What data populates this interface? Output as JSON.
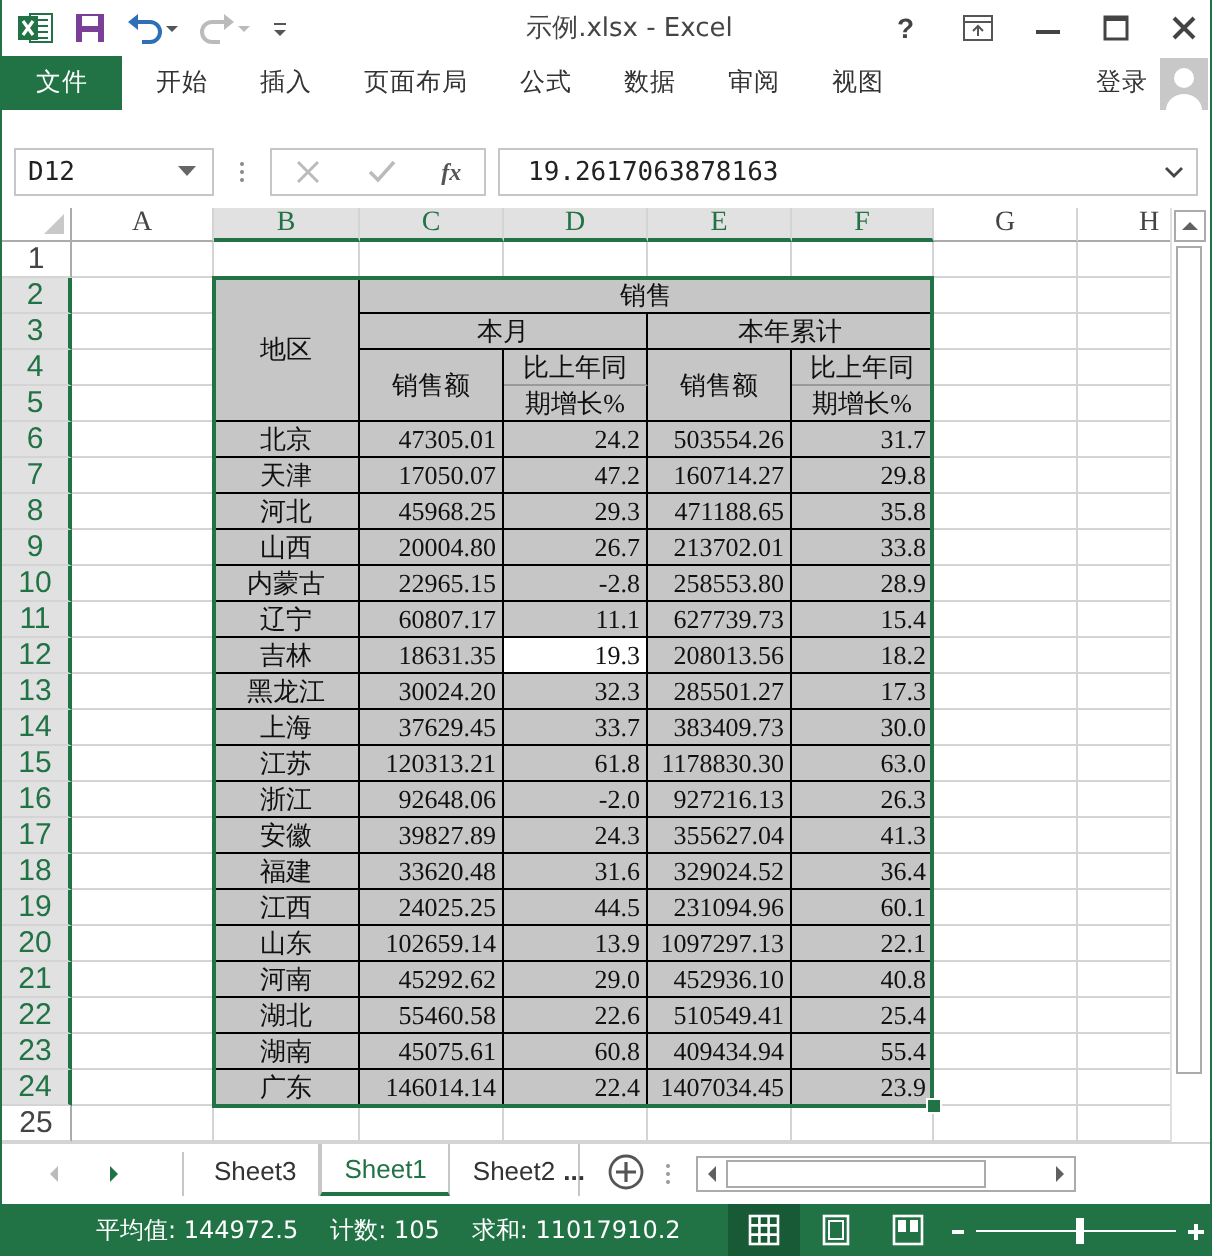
{
  "window": {
    "title": "示例.xlsx - Excel",
    "help": "?"
  },
  "ribbon": {
    "tabs": [
      {
        "label": "文件",
        "kind": "file"
      },
      {
        "label": "开始",
        "kind": "tab"
      },
      {
        "label": "插入",
        "kind": "tab"
      },
      {
        "label": "页面布局",
        "kind": "tab"
      },
      {
        "label": "公式",
        "kind": "tab"
      },
      {
        "label": "数据",
        "kind": "tab"
      },
      {
        "label": "审阅",
        "kind": "tab"
      },
      {
        "label": "视图",
        "kind": "tab"
      }
    ],
    "account": "登录"
  },
  "formula_bar": {
    "name_box": "D12",
    "function_label": "fx",
    "formula": "19.2617063878163"
  },
  "columns": [
    {
      "label": "A",
      "selected": false
    },
    {
      "label": "B",
      "selected": true
    },
    {
      "label": "C",
      "selected": true
    },
    {
      "label": "D",
      "selected": true
    },
    {
      "label": "E",
      "selected": true
    },
    {
      "label": "F",
      "selected": true
    },
    {
      "label": "G",
      "selected": false
    },
    {
      "label": "H",
      "selected": false
    }
  ],
  "rows": [
    {
      "label": "1",
      "selected": false
    },
    {
      "label": "2",
      "selected": true
    },
    {
      "label": "3",
      "selected": true
    },
    {
      "label": "4",
      "selected": true
    },
    {
      "label": "5",
      "selected": true
    },
    {
      "label": "6",
      "selected": true
    },
    {
      "label": "7",
      "selected": true
    },
    {
      "label": "8",
      "selected": true
    },
    {
      "label": "9",
      "selected": true
    },
    {
      "label": "10",
      "selected": true
    },
    {
      "label": "11",
      "selected": true
    },
    {
      "label": "12",
      "selected": true
    },
    {
      "label": "13",
      "selected": true
    },
    {
      "label": "14",
      "selected": true
    },
    {
      "label": "15",
      "selected": true
    },
    {
      "label": "16",
      "selected": true
    },
    {
      "label": "17",
      "selected": true
    },
    {
      "label": "18",
      "selected": true
    },
    {
      "label": "19",
      "selected": true
    },
    {
      "label": "20",
      "selected": true
    },
    {
      "label": "21",
      "selected": true
    },
    {
      "label": "22",
      "selected": true
    },
    {
      "label": "23",
      "selected": true
    },
    {
      "label": "24",
      "selected": true
    },
    {
      "label": "25",
      "selected": false
    }
  ],
  "table": {
    "title": "销售",
    "region_header": "地区",
    "groups": [
      "本月",
      "本年累计"
    ],
    "subheaders": [
      {
        "kind": "amount",
        "lines": [
          "销售额"
        ]
      },
      {
        "kind": "growth",
        "lines": [
          "比上年同",
          "期增长%"
        ]
      },
      {
        "kind": "amount",
        "lines": [
          "销售额"
        ]
      },
      {
        "kind": "growth",
        "lines": [
          "比上年同",
          "期增长%"
        ]
      }
    ],
    "data": [
      {
        "cells": [
          {
            "text": "北京",
            "selected": false
          },
          {
            "text": "47305.01",
            "selected": false
          },
          {
            "text": "24.2",
            "selected": false
          },
          {
            "text": "503554.26",
            "selected": false
          },
          {
            "text": "31.7",
            "selected": false
          }
        ]
      },
      {
        "cells": [
          {
            "text": "天津",
            "selected": false
          },
          {
            "text": "17050.07",
            "selected": false
          },
          {
            "text": "47.2",
            "selected": false
          },
          {
            "text": "160714.27",
            "selected": false
          },
          {
            "text": "29.8",
            "selected": false
          }
        ]
      },
      {
        "cells": [
          {
            "text": "河北",
            "selected": false
          },
          {
            "text": "45968.25",
            "selected": false
          },
          {
            "text": "29.3",
            "selected": false
          },
          {
            "text": "471188.65",
            "selected": false
          },
          {
            "text": "35.8",
            "selected": false
          }
        ]
      },
      {
        "cells": [
          {
            "text": "山西",
            "selected": false
          },
          {
            "text": "20004.80",
            "selected": false
          },
          {
            "text": "26.7",
            "selected": false
          },
          {
            "text": "213702.01",
            "selected": false
          },
          {
            "text": "33.8",
            "selected": false
          }
        ]
      },
      {
        "cells": [
          {
            "text": "内蒙古",
            "selected": false
          },
          {
            "text": "22965.15",
            "selected": false
          },
          {
            "text": "-2.8",
            "selected": false
          },
          {
            "text": "258553.80",
            "selected": false
          },
          {
            "text": "28.9",
            "selected": false
          }
        ]
      },
      {
        "cells": [
          {
            "text": "辽宁",
            "selected": false
          },
          {
            "text": "60807.17",
            "selected": false
          },
          {
            "text": "11.1",
            "selected": false
          },
          {
            "text": "627739.73",
            "selected": false
          },
          {
            "text": "15.4",
            "selected": false
          }
        ]
      },
      {
        "cells": [
          {
            "text": "吉林",
            "selected": false
          },
          {
            "text": "18631.35",
            "selected": false
          },
          {
            "text": "19.3",
            "selected": true
          },
          {
            "text": "208013.56",
            "selected": false
          },
          {
            "text": "18.2",
            "selected": false
          }
        ]
      },
      {
        "cells": [
          {
            "text": "黑龙江",
            "selected": false
          },
          {
            "text": "30024.20",
            "selected": false
          },
          {
            "text": "32.3",
            "selected": false
          },
          {
            "text": "285501.27",
            "selected": false
          },
          {
            "text": "17.3",
            "selected": false
          }
        ]
      },
      {
        "cells": [
          {
            "text": "上海",
            "selected": false
          },
          {
            "text": "37629.45",
            "selected": false
          },
          {
            "text": "33.7",
            "selected": false
          },
          {
            "text": "383409.73",
            "selected": false
          },
          {
            "text": "30.0",
            "selected": false
          }
        ]
      },
      {
        "cells": [
          {
            "text": "江苏",
            "selected": false
          },
          {
            "text": "120313.21",
            "selected": false
          },
          {
            "text": "61.8",
            "selected": false
          },
          {
            "text": "1178830.30",
            "selected": false
          },
          {
            "text": "63.0",
            "selected": false
          }
        ]
      },
      {
        "cells": [
          {
            "text": "浙江",
            "selected": false
          },
          {
            "text": "92648.06",
            "selected": false
          },
          {
            "text": "-2.0",
            "selected": false
          },
          {
            "text": "927216.13",
            "selected": false
          },
          {
            "text": "26.3",
            "selected": false
          }
        ]
      },
      {
        "cells": [
          {
            "text": "安徽",
            "selected": false
          },
          {
            "text": "39827.89",
            "selected": false
          },
          {
            "text": "24.3",
            "selected": false
          },
          {
            "text": "355627.04",
            "selected": false
          },
          {
            "text": "41.3",
            "selected": false
          }
        ]
      },
      {
        "cells": [
          {
            "text": "福建",
            "selected": false
          },
          {
            "text": "33620.48",
            "selected": false
          },
          {
            "text": "31.6",
            "selected": false
          },
          {
            "text": "329024.52",
            "selected": false
          },
          {
            "text": "36.4",
            "selected": false
          }
        ]
      },
      {
        "cells": [
          {
            "text": "江西",
            "selected": false
          },
          {
            "text": "24025.25",
            "selected": false
          },
          {
            "text": "44.5",
            "selected": false
          },
          {
            "text": "231094.96",
            "selected": false
          },
          {
            "text": "60.1",
            "selected": false
          }
        ]
      },
      {
        "cells": [
          {
            "text": "山东",
            "selected": false
          },
          {
            "text": "102659.14",
            "selected": false
          },
          {
            "text": "13.9",
            "selected": false
          },
          {
            "text": "1097297.13",
            "selected": false
          },
          {
            "text": "22.1",
            "selected": false
          }
        ]
      },
      {
        "cells": [
          {
            "text": "河南",
            "selected": false
          },
          {
            "text": "45292.62",
            "selected": false
          },
          {
            "text": "29.0",
            "selected": false
          },
          {
            "text": "452936.10",
            "selected": false
          },
          {
            "text": "40.8",
            "selected": false
          }
        ]
      },
      {
        "cells": [
          {
            "text": "湖北",
            "selected": false
          },
          {
            "text": "55460.58",
            "selected": false
          },
          {
            "text": "22.6",
            "selected": false
          },
          {
            "text": "510549.41",
            "selected": false
          },
          {
            "text": "25.4",
            "selected": false
          }
        ]
      },
      {
        "cells": [
          {
            "text": "湖南",
            "selected": false
          },
          {
            "text": "45075.61",
            "selected": false
          },
          {
            "text": "60.8",
            "selected": false
          },
          {
            "text": "409434.94",
            "selected": false
          },
          {
            "text": "55.4",
            "selected": false
          }
        ]
      },
      {
        "cells": [
          {
            "text": "广东",
            "selected": false
          },
          {
            "text": "146014.14",
            "selected": false
          },
          {
            "text": "22.4",
            "selected": false
          },
          {
            "text": "1407034.45",
            "selected": false
          },
          {
            "text": "23.9",
            "selected": false
          }
        ]
      }
    ]
  },
  "sheet_tabs": [
    {
      "label": "Sheet3",
      "selected": false
    },
    {
      "label": "Sheet1",
      "selected": true
    },
    {
      "label": "Sheet2",
      "selected": false
    }
  ],
  "more_tabs": "...",
  "status_bar": {
    "stats": [
      "平均值: 144972.5",
      "计数: 105",
      "求和: 11017910.2"
    ],
    "views": [
      {
        "kind": "normal",
        "selected": true
      },
      {
        "kind": "page_layout",
        "selected": false
      },
      {
        "kind": "page_break",
        "selected": false
      }
    ],
    "zoom": {
      "level": 0.52
    }
  }
}
